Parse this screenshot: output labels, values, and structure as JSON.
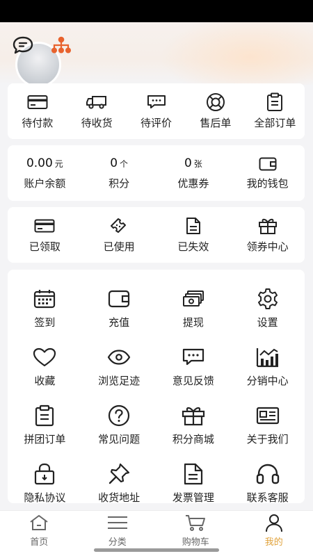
{
  "colors": {
    "accent": "#e0a23b",
    "org_icon": "#e8622d",
    "text": "#222222"
  },
  "orders": [
    {
      "label": "待付款",
      "icon": "card-icon"
    },
    {
      "label": "待收货",
      "icon": "truck-icon"
    },
    {
      "label": "待评价",
      "icon": "comment-icon"
    },
    {
      "label": "售后单",
      "icon": "lifebuoy-icon"
    },
    {
      "label": "全部订单",
      "icon": "clipboard-icon"
    }
  ],
  "assets": {
    "balance": {
      "value": "0.00",
      "unit": "元",
      "label": "账户余额"
    },
    "points": {
      "value": "0",
      "unit": "个",
      "label": "积分"
    },
    "coupons": {
      "value": "0",
      "unit": "张",
      "label": "优惠券"
    },
    "wallet": {
      "label": "我的钱包",
      "icon": "wallet-icon"
    }
  },
  "coupon_status": [
    {
      "label": "已领取",
      "icon": "card-icon"
    },
    {
      "label": "已使用",
      "icon": "ticket-icon"
    },
    {
      "label": "已失效",
      "icon": "document-icon"
    },
    {
      "label": "领券中心",
      "icon": "gift-icon"
    }
  ],
  "tools": [
    {
      "label": "签到",
      "icon": "calendar-icon"
    },
    {
      "label": "充值",
      "icon": "wallet-icon"
    },
    {
      "label": "提现",
      "icon": "cash-icon"
    },
    {
      "label": "设置",
      "icon": "gear-icon"
    },
    {
      "label": "收藏",
      "icon": "heart-icon"
    },
    {
      "label": "浏览足迹",
      "icon": "eye-icon"
    },
    {
      "label": "意见反馈",
      "icon": "comment-icon"
    },
    {
      "label": "分销中心",
      "icon": "bar-chart-icon"
    },
    {
      "label": "拼团订单",
      "icon": "clipboard-icon"
    },
    {
      "label": "常见问题",
      "icon": "question-icon"
    },
    {
      "label": "积分商城",
      "icon": "gift-icon"
    },
    {
      "label": "关于我们",
      "icon": "id-card-icon"
    },
    {
      "label": "隐私协议",
      "icon": "lock-icon"
    },
    {
      "label": "收货地址",
      "icon": "pin-icon"
    },
    {
      "label": "发票管理",
      "icon": "document-icon"
    },
    {
      "label": "联系客服",
      "icon": "headset-icon"
    }
  ],
  "tabbar": [
    {
      "label": "首页",
      "icon": "home-icon",
      "active": false
    },
    {
      "label": "分类",
      "icon": "menu-icon",
      "active": false
    },
    {
      "label": "购物车",
      "icon": "cart-icon",
      "active": false
    },
    {
      "label": "我的",
      "icon": "user-icon",
      "active": true
    }
  ]
}
